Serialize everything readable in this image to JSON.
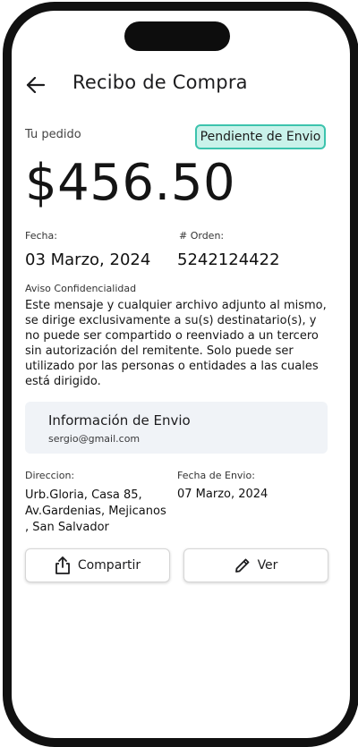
{
  "header": {
    "title": "Recibo de Compra",
    "back_icon": "arrow-left-icon"
  },
  "order": {
    "section_label": "Tu pedido",
    "status": "Pendiente de Envio",
    "status_color": "#c9f2ea",
    "status_border": "#3cc3ad",
    "amount": "$456.50",
    "date_label": "Fecha:",
    "date_value": "03 Marzo, 2024",
    "order_label": "#  Orden:",
    "order_value": "5242124422"
  },
  "notice": {
    "label": "Aviso Confidencialidad",
    "text": "Este mensaje y cualquier archivo adjunto al mismo, se dirige exclusivamente a su(s) destinatario(s), y no puede ser compartido o reenviado a un tercero sin autorización del remitente. Solo puede ser utilizado por las personas o entidades a las cuales está dirigido."
  },
  "shipping": {
    "title": "Información de Envio",
    "email": "sergio@gmail.com",
    "address_label": "Direccion:",
    "address_value": "Urb.Gloria, Casa 85, Av.Gardenias, Mejicanos , San Salvador",
    "ship_date_label": "Fecha de Envio:",
    "ship_date_value": "07 Marzo, 2024"
  },
  "actions": {
    "share_label": "Compartir",
    "share_icon": "share-icon",
    "view_label": "Ver",
    "view_icon": "pencil-icon"
  }
}
